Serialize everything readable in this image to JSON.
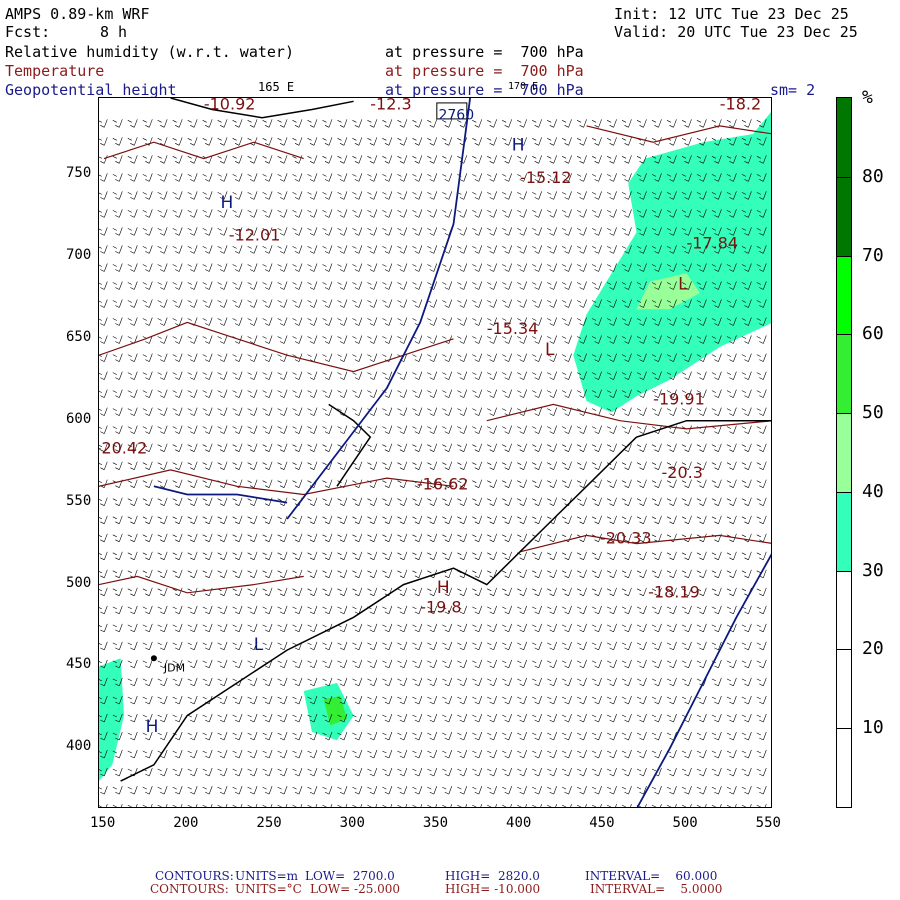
{
  "header": {
    "model": "AMPS 0.89-km WRF",
    "init": "Init: 12 UTC Tue 23 Dec 25",
    "fcst_label": "Fcst:",
    "fcst_value": "8 h",
    "valid": "Valid: 20 UTC Tue 23 Dec 25",
    "field1": "Relative humidity (w.r.t. water)",
    "field1_level": "at pressure =  700 hPa",
    "field2": "Temperature",
    "field2_level": "at pressure =  700 hPa",
    "field3": "Geopotential height",
    "field3_level": "at pressure =  700 hPa",
    "meridian": "165 E",
    "meridian2": "170 E",
    "smoothing": "sm= 2"
  },
  "axes": {
    "x_ticks": [
      150,
      200,
      250,
      300,
      350,
      400,
      450,
      500,
      550
    ],
    "y_ticks": [
      400,
      450,
      500,
      550,
      600,
      650,
      700,
      750
    ],
    "x_range": [
      147,
      552
    ],
    "y_range": [
      363,
      797
    ]
  },
  "colorbar": {
    "unit": "%",
    "labels": [
      10,
      20,
      30,
      40,
      50,
      60,
      70,
      80
    ],
    "colors": {
      "0-30": "#ffffff",
      "30-40": "#33ffbb",
      "40-50": "#99ff99",
      "50-60": "#33ee33",
      "60-70": "#00ff00",
      "70-100": "#007700"
    }
  },
  "map_labels": {
    "height_box_top": "2760",
    "stations": [
      "JDM"
    ],
    "temps": [
      "-10.92",
      "-12.3",
      "-18.2",
      "-15.12",
      "-12.01",
      "-17.84",
      "-15.34",
      "-19.91",
      "-20.3",
      "-20.42",
      "-16.62",
      "-20.33",
      "-18.19",
      "-19.8"
    ],
    "highs_lows": [
      "H",
      "L",
      "H",
      "H",
      "L",
      "L",
      "H"
    ]
  },
  "footer": {
    "line1": {
      "label": "CONTOURS:",
      "units": "UNITS=m",
      "low": "LOW=  2700.0",
      "high": "HIGH=  2820.0",
      "interval": "INTERVAL=    60.000"
    },
    "line2": {
      "label": "CONTOURS:",
      "units": "UNITS=°C",
      "low": "LOW= -25.000",
      "high": "HIGH= -10.000",
      "interval": "INTERVAL=    5.0000"
    }
  },
  "palette": {
    "height_contour": "#0c1a80",
    "temp_contour": "#7a1010",
    "coast": "#000000",
    "barb": "#000000"
  }
}
